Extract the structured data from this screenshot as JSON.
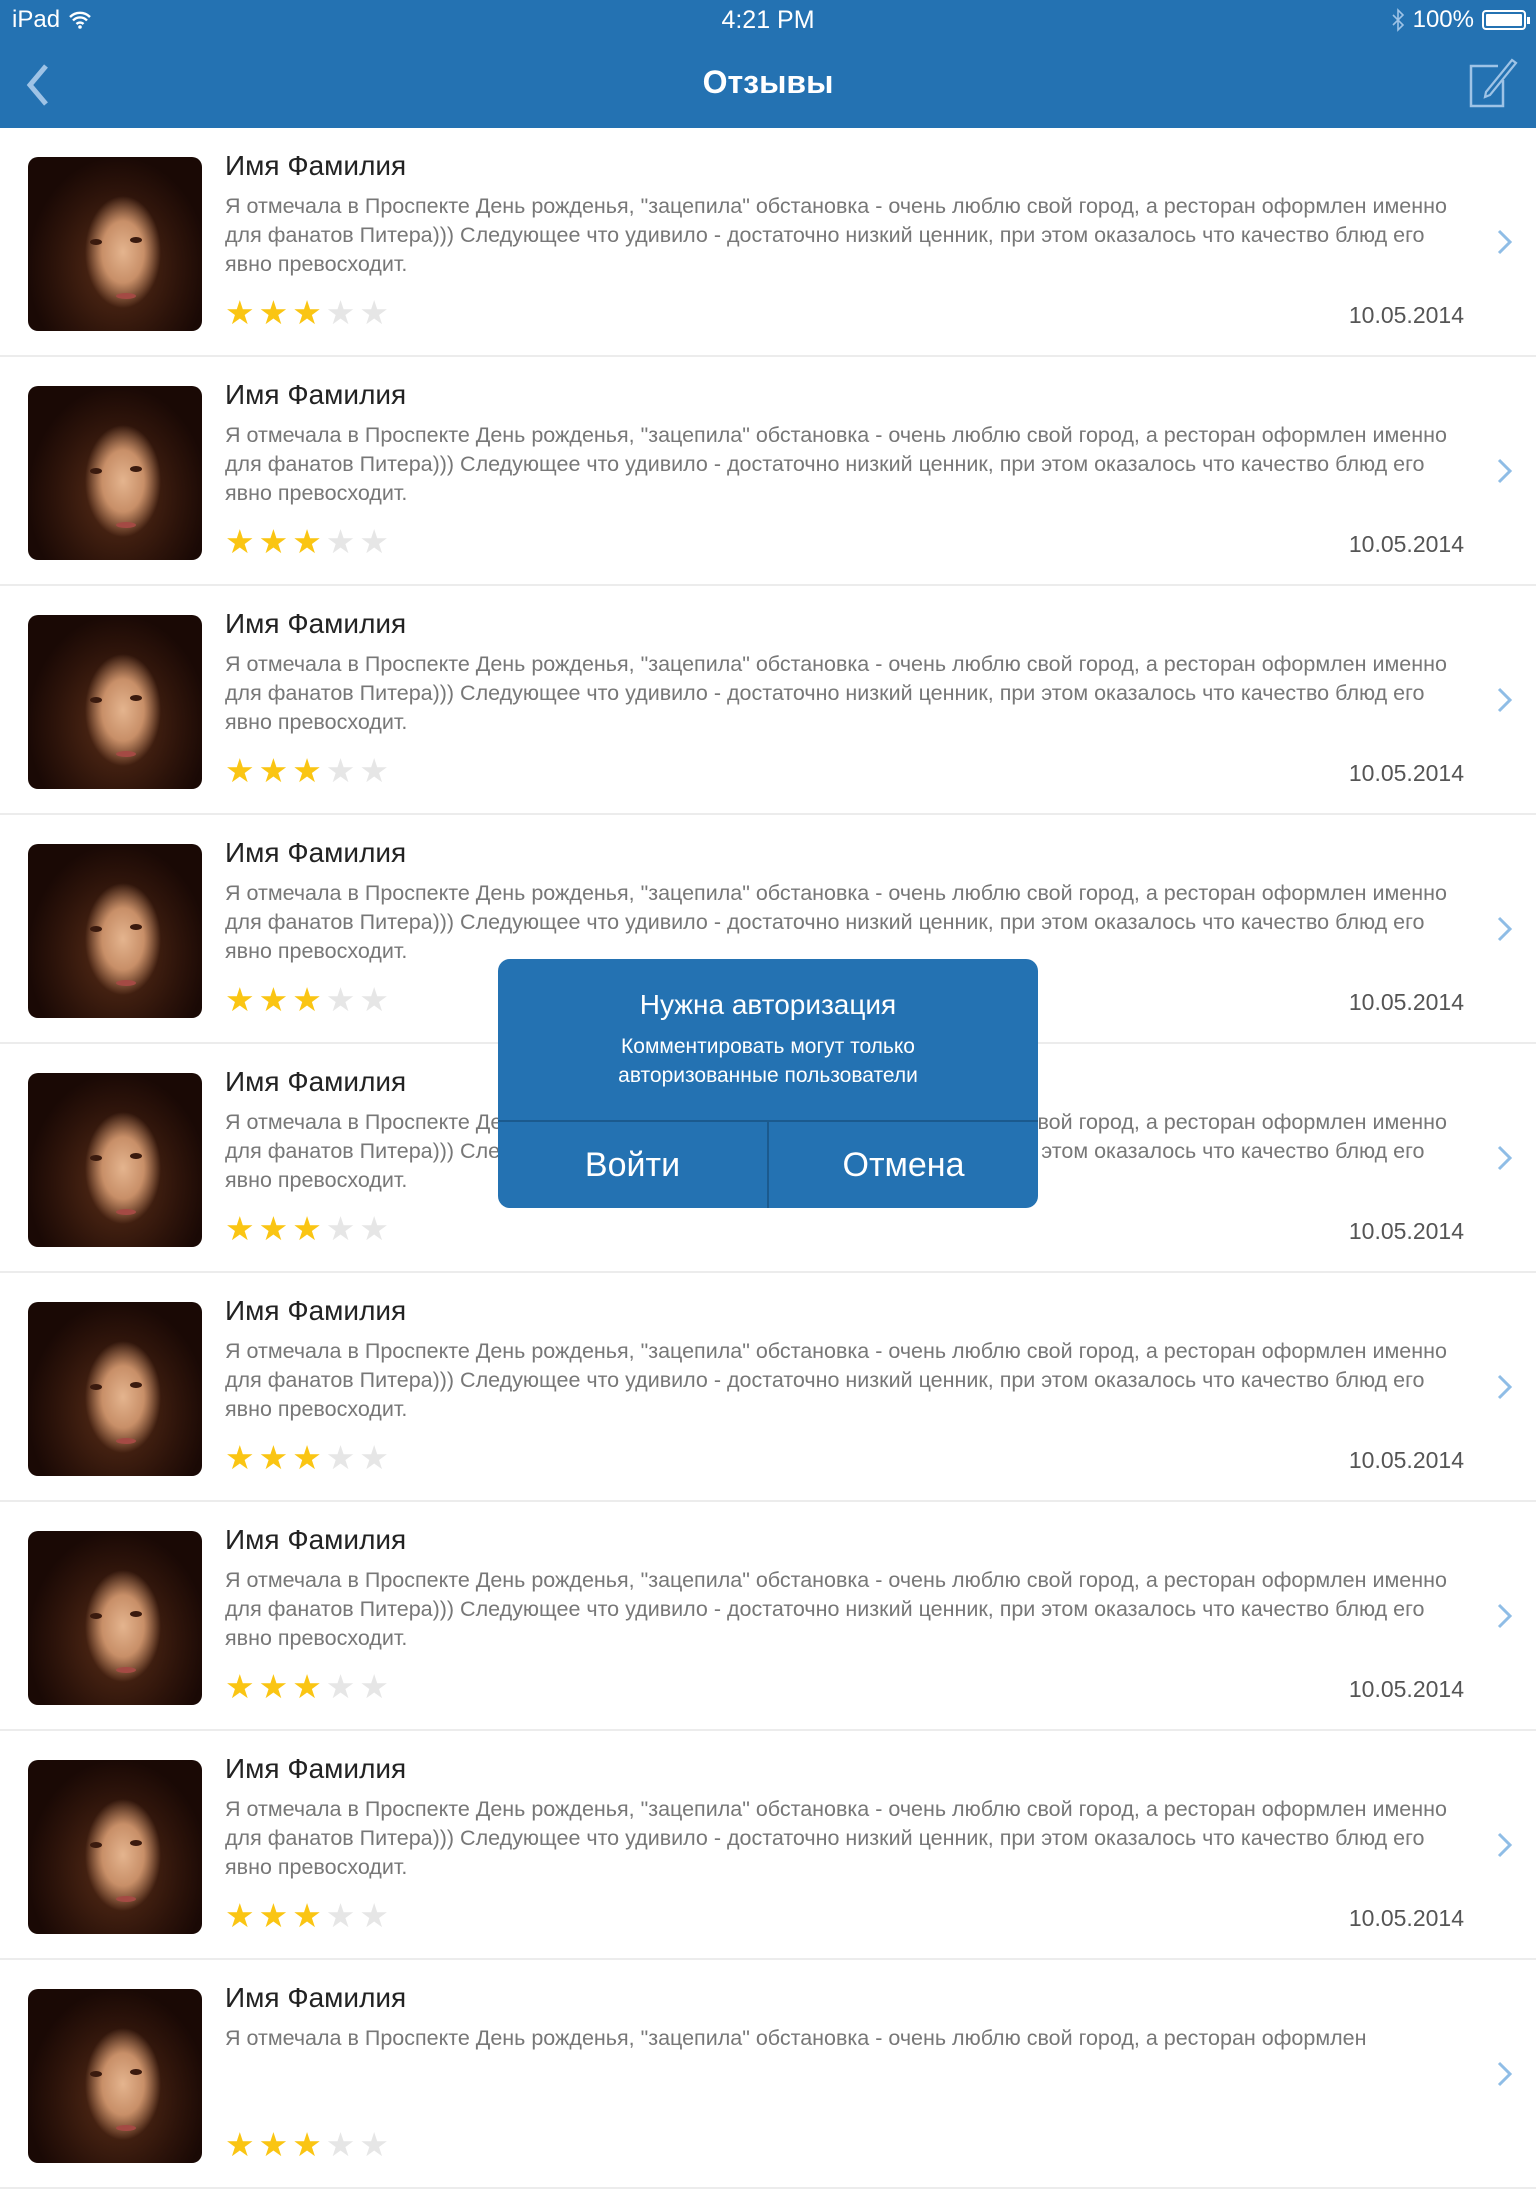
{
  "status_bar": {
    "device": "iPad",
    "time": "4:21 PM",
    "battery": "100%"
  },
  "nav": {
    "title": "Отзывы"
  },
  "reviews": [
    {
      "name": "Имя Фамилия",
      "text": "Я отмечала в Проспекте День рожденья, \"зацепила\" обстановка - очень люблю свой город, а ресторан оформлен именно для фанатов Питера))) Следующее что удивило - достаточно низкий ценник, при этом оказалось что качество блюд его явно превосходит.",
      "rating": 3,
      "date": "10.05.2014"
    },
    {
      "name": "Имя Фамилия",
      "text": "Я отмечала в Проспекте День рожденья, \"зацепила\" обстановка - очень люблю свой город, а ресторан оформлен именно для фанатов Питера))) Следующее что удивило - достаточно низкий ценник, при этом оказалось что качество блюд его явно превосходит.",
      "rating": 3,
      "date": "10.05.2014"
    },
    {
      "name": "Имя Фамилия",
      "text": "Я отмечала в Проспекте День рожденья, \"зацепила\" обстановка - очень люблю свой город, а ресторан оформлен именно для фанатов Питера))) Следующее что удивило - достаточно низкий ценник, при этом оказалось что качество блюд его явно превосходит.",
      "rating": 3,
      "date": "10.05.2014"
    },
    {
      "name": "Имя Фамилия",
      "text": "Я отмечала в Проспекте День рожденья, \"зацепила\" обстановка - очень люблю свой город, а ресторан оформлен именно для фанатов Питера))) Следующее что удивило - достаточно низкий ценник, при этом оказалось что качество блюд его явно превосходит.",
      "rating": 3,
      "date": "10.05.2014"
    },
    {
      "name": "Имя Фамилия",
      "text": "Я отмечала в Проспекте День рожденья, \"зацепила\" обстановка - очень люблю свой город, а ресторан оформлен именно для фанатов Питера))) Следующее что удивило - достаточно низкий ценник, при этом оказалось что качество блюд его явно превосходит.",
      "rating": 3,
      "date": "10.05.2014"
    },
    {
      "name": "Имя Фамилия",
      "text": "Я отмечала в Проспекте День рожденья, \"зацепила\" обстановка - очень люблю свой город, а ресторан оформлен именно для фанатов Питера))) Следующее что удивило - достаточно низкий ценник, при этом оказалось что качество блюд его явно превосходит.",
      "rating": 3,
      "date": "10.05.2014"
    },
    {
      "name": "Имя Фамилия",
      "text": "Я отмечала в Проспекте День рожденья, \"зацепила\" обстановка - очень люблю свой город, а ресторан оформлен именно для фанатов Питера))) Следующее что удивило - достаточно низкий ценник, при этом оказалось что качество блюд его явно превосходит.",
      "rating": 3,
      "date": "10.05.2014"
    },
    {
      "name": "Имя Фамилия",
      "text": "Я отмечала в Проспекте День рожденья, \"зацепила\" обстановка - очень люблю свой город, а ресторан оформлен именно для фанатов Питера))) Следующее что удивило - достаточно низкий ценник, при этом оказалось что качество блюд его явно превосходит.",
      "rating": 3,
      "date": "10.05.2014"
    },
    {
      "name": "Имя Фамилия",
      "text": "Я отмечала в Проспекте День рожденья, \"зацепила\" обстановка - очень люблю свой город, а ресторан оформлен",
      "rating": 3,
      "date": ""
    }
  ],
  "dialog": {
    "title": "Нужна авторизация",
    "message_line1": "Комментировать могут только",
    "message_line2": "авторизованные пользователи",
    "login": "Войти",
    "cancel": "Отмена"
  },
  "colors": {
    "accent": "#2472b2",
    "star": "#fac513"
  }
}
